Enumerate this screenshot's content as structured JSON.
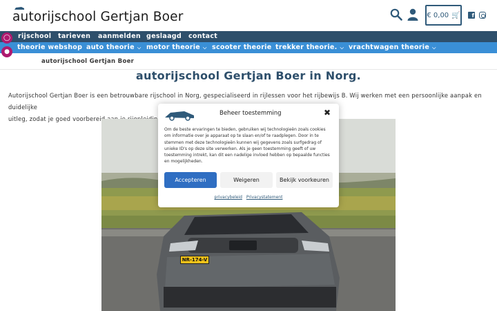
{
  "header": {
    "site_title": "autorijschool Gertjan Boer",
    "cart_label": "€ 0,00",
    "icons": [
      "search-icon",
      "user-icon",
      "cart-icon",
      "facebook-icon",
      "instagram-icon"
    ]
  },
  "nav_primary": [
    {
      "label": "rijschool"
    },
    {
      "label": "tarieven"
    },
    {
      "label": "aanmelden"
    },
    {
      "label": "geslaagd"
    },
    {
      "label": "contact"
    }
  ],
  "nav_secondary": [
    {
      "label": "theorie webshop",
      "dropdown": false
    },
    {
      "label": "auto theorie",
      "dropdown": true
    },
    {
      "label": "motor theorie",
      "dropdown": true
    },
    {
      "label": "scooter theorie",
      "dropdown": false
    },
    {
      "label": "trekker theorie.",
      "dropdown": true
    },
    {
      "label": "vrachtwagen theorie",
      "dropdown": true
    }
  ],
  "breadcrumb": "autorijschool Gertjan Boer",
  "main": {
    "title": "autorijschool Gertjan Boer in Norg.",
    "intro_line1": "Autorijschool Gertjan Boer is een betrouwbare rijschool in Norg, gespecialiseerd in rijlessen voor het rijbewijs B. Wij werken met een persoonlijke aanpak en duidelijke",
    "intro_line2": "uitleg, zodat je goed voorbereid aan je rijopleiding b",
    "plate_text": "NR-174-V"
  },
  "cookie_modal": {
    "title": "Beheer toestemming",
    "body": "Om de beste ervaringen te bieden, gebruiken wij technologieën zoals cookies om informatie over je apparaat op te slaan en/of te raadplegen. Door in te stemmen met deze technologieën kunnen wij gegevens zoals surfgedrag of unieke ID's op deze site verwerken. Als je geen toestemming geeft of uw toestemming intrekt, kan dit een nadelige invloed hebben op bepaalde functies en mogelijkheden.",
    "accept_label": "Accepteren",
    "deny_label": "Weigeren",
    "prefs_label": "Bekijk voorkeuren",
    "link_privacy": "privacybeleid",
    "link_statement": "Privacystatement"
  },
  "colors": {
    "nav_primary_bg": "#2e4f6b",
    "nav_secondary_bg": "#3a8fd6",
    "accent": "#2f6ec2",
    "float_button": "#ae1a6f"
  }
}
